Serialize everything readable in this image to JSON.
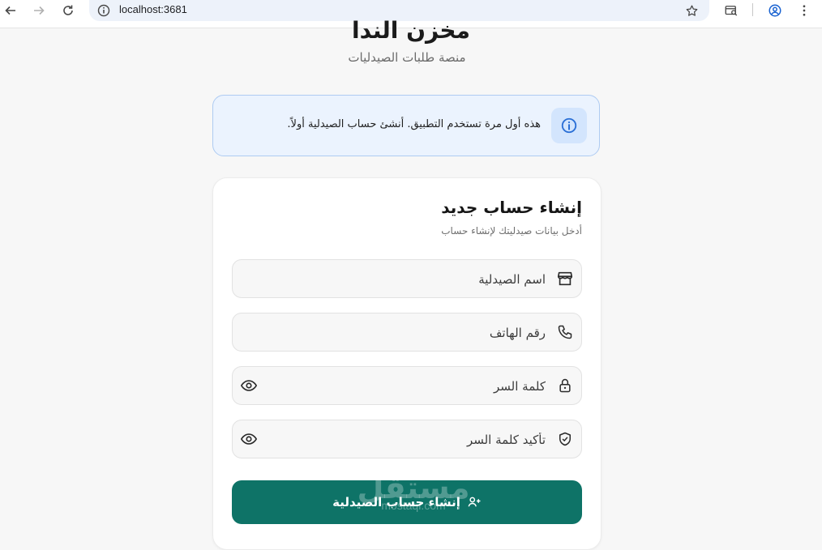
{
  "browser": {
    "url": "localhost:3681",
    "back_icon": "arrow-left-icon",
    "forward_icon": "arrow-right-icon",
    "reload_icon": "reload-icon"
  },
  "header": {
    "title": "مخزن الندا",
    "subtitle": "منصة طلبات الصيدليات"
  },
  "notice": {
    "text": "هذه أول مرة تستخدم التطبيق. أنشئ حساب الصيدلية أولاً.",
    "icon": "info-icon"
  },
  "form": {
    "title": "إنشاء حساب جديد",
    "subtitle": "أدخل بيانات صيدليتك لإنشاء حساب",
    "fields": {
      "pharmacy_name": {
        "placeholder": "اسم الصيدلية",
        "value": ""
      },
      "phone": {
        "placeholder": "رقم الهاتف",
        "value": ""
      },
      "password": {
        "placeholder": "كلمة السر",
        "value": ""
      },
      "confirm_password": {
        "placeholder": "تأكيد كلمة السر",
        "value": ""
      }
    },
    "submit_label": "إنشاء حساب الصيدلية"
  },
  "watermark": {
    "arabic": "مستقل",
    "latin": "mostaql.com"
  },
  "colors": {
    "primary": "#0e7367",
    "info_bg": "#ebf3fe",
    "info_border": "#aecbf2",
    "info_icon": "#2a6fd6"
  }
}
